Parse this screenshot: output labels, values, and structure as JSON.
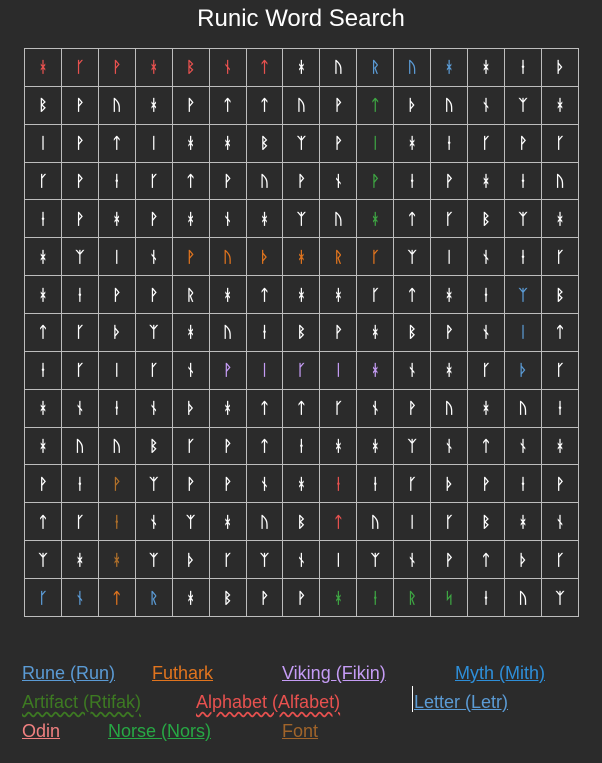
{
  "title": "Runic Word Search",
  "grid": [
    [
      "ᚼ",
      "ᚴ",
      "ᚹ",
      "ᚼ",
      "ᛒ",
      "ᚾ",
      "ᛏ",
      "ᚼ",
      "ᚢ",
      "ᚱ",
      "ᚢ",
      "ᚼ",
      "ᚼ",
      "ᚽ",
      "ᚦ"
    ],
    [
      "ᛒ",
      "ᚹ",
      "ᚢ",
      "ᚼ",
      "ᚹ",
      "ᛏ",
      "ᛏ",
      "ᚢ",
      "ᚹ",
      "ᛏ",
      "ᚦ",
      "ᚢ",
      "ᚾ",
      "ᛉ",
      "ᚼ"
    ],
    [
      "ᛁ",
      "ᚹ",
      "ᛏ",
      "ᛁ",
      "ᚼ",
      "ᚼ",
      "ᛒ",
      "ᛉ",
      "ᚹ",
      "ᛁ",
      "ᚼ",
      "ᚽ",
      "ᚴ",
      "ᚹ",
      "ᚴ"
    ],
    [
      "ᚴ",
      "ᚹ",
      "ᚽ",
      "ᚴ",
      "ᛏ",
      "ᚹ",
      "ᚢ",
      "ᚹ",
      "ᚾ",
      "ᚹ",
      "ᚽ",
      "ᚹ",
      "ᚼ",
      "ᚽ",
      "ᚢ"
    ],
    [
      "ᚽ",
      "ᚹ",
      "ᚼ",
      "ᚹ",
      "ᚼ",
      "ᚾ",
      "ᚼ",
      "ᛉ",
      "ᚢ",
      "ᚼ",
      "ᛏ",
      "ᚴ",
      "ᛒ",
      "ᛉ",
      "ᚼ"
    ],
    [
      "ᚼ",
      "ᛉ",
      "ᛁ",
      "ᚾ",
      "ᚹ",
      "ᚢ",
      "ᚦ",
      "ᚼ",
      "ᚱ",
      "ᚴ",
      "ᛉ",
      "ᛁ",
      "ᚾ",
      "ᚽ",
      "ᚴ"
    ],
    [
      "ᚼ",
      "ᚽ",
      "ᚹ",
      "ᚹ",
      "ᚱ",
      "ᚼ",
      "ᛏ",
      "ᚼ",
      "ᚼ",
      "ᚴ",
      "ᛏ",
      "ᚼ",
      "ᚽ",
      "ᛉ",
      "ᛒ"
    ],
    [
      "ᛏ",
      "ᚴ",
      "ᚦ",
      "ᛉ",
      "ᚼ",
      "ᚢ",
      "ᚽ",
      "ᛒ",
      "ᚹ",
      "ᚼ",
      "ᛒ",
      "ᚹ",
      "ᚾ",
      "ᛁ",
      "ᛏ"
    ],
    [
      "ᚽ",
      "ᚴ",
      "ᛁ",
      "ᚴ",
      "ᚾ",
      "ᚹ",
      "ᛁ",
      "ᚴ",
      "ᛁ",
      "ᚼ",
      "ᚾ",
      "ᚼ",
      "ᚴ",
      "ᚦ",
      "ᚴ"
    ],
    [
      "ᚼ",
      "ᚾ",
      "ᚽ",
      "ᚾ",
      "ᚦ",
      "ᚼ",
      "ᛏ",
      "ᛏ",
      "ᚴ",
      "ᚾ",
      "ᚹ",
      "ᚢ",
      "ᚼ",
      "ᚢ",
      "ᚽ"
    ],
    [
      "ᚼ",
      "ᚢ",
      "ᚢ",
      "ᛒ",
      "ᚴ",
      "ᚹ",
      "ᛏ",
      "ᚽ",
      "ᚼ",
      "ᚼ",
      "ᛉ",
      "ᚾ",
      "ᛏ",
      "ᚾ",
      "ᚼ"
    ],
    [
      "ᚹ",
      "ᚽ",
      "ᚹ",
      "ᛉ",
      "ᚹ",
      "ᚹ",
      "ᚾ",
      "ᚼ",
      "ᚽ",
      "ᚽ",
      "ᚴ",
      "ᚦ",
      "ᚹ",
      "ᚽ",
      "ᚹ"
    ],
    [
      "ᛏ",
      "ᚴ",
      "ᚽ",
      "ᚾ",
      "ᛉ",
      "ᚼ",
      "ᚢ",
      "ᛒ",
      "ᛏ",
      "ᚢ",
      "ᛁ",
      "ᚴ",
      "ᛒ",
      "ᚼ",
      "ᚾ"
    ],
    [
      "ᛉ",
      "ᚼ",
      "ᚼ",
      "ᛉ",
      "ᚦ",
      "ᚴ",
      "ᛉ",
      "ᚾ",
      "ᛁ",
      "ᛉ",
      "ᚾ",
      "ᚹ",
      "ᛏ",
      "ᚦ",
      "ᚴ"
    ],
    [
      "ᚴ",
      "ᚾ",
      "ᛏ",
      "ᚱ",
      "ᚼ",
      "ᛒ",
      "ᚹ",
      "ᚹ",
      "ᚼ",
      "ᚽ",
      "ᚱ",
      "ᛋ",
      "ᚽ",
      "ᚢ",
      "ᛉ"
    ]
  ],
  "highlights": [
    {
      "r": 0,
      "c": 0,
      "color": "#e8514f"
    },
    {
      "r": 0,
      "c": 1,
      "color": "#e8514f"
    },
    {
      "r": 0,
      "c": 2,
      "color": "#e8514f"
    },
    {
      "r": 0,
      "c": 3,
      "color": "#e8514f"
    },
    {
      "r": 0,
      "c": 4,
      "color": "#e8514f"
    },
    {
      "r": 0,
      "c": 5,
      "color": "#e8514f"
    },
    {
      "r": 0,
      "c": 6,
      "color": "#e8514f"
    },
    {
      "r": 0,
      "c": 9,
      "color": "#5b9bd5"
    },
    {
      "r": 0,
      "c": 10,
      "color": "#5b9bd5"
    },
    {
      "r": 0,
      "c": 11,
      "color": "#5b9bd5"
    },
    {
      "r": 1,
      "c": 9,
      "color": "#3ea643"
    },
    {
      "r": 2,
      "c": 9,
      "color": "#3ea643"
    },
    {
      "r": 3,
      "c": 9,
      "color": "#3ea643"
    },
    {
      "r": 4,
      "c": 9,
      "color": "#3ea643"
    },
    {
      "r": 5,
      "c": 4,
      "color": "#e0741e"
    },
    {
      "r": 5,
      "c": 5,
      "color": "#e0741e"
    },
    {
      "r": 5,
      "c": 6,
      "color": "#e0741e"
    },
    {
      "r": 5,
      "c": 7,
      "color": "#e0741e"
    },
    {
      "r": 5,
      "c": 8,
      "color": "#e0741e"
    },
    {
      "r": 5,
      "c": 9,
      "color": "#e0741e"
    },
    {
      "r": 6,
      "c": 13,
      "color": "#5b9bd5"
    },
    {
      "r": 7,
      "c": 13,
      "color": "#5b9bd5"
    },
    {
      "r": 8,
      "c": 13,
      "color": "#5b9bd5"
    },
    {
      "r": 8,
      "c": 5,
      "color": "#c59cf5"
    },
    {
      "r": 8,
      "c": 6,
      "color": "#c59cf5"
    },
    {
      "r": 8,
      "c": 7,
      "color": "#c59cf5"
    },
    {
      "r": 8,
      "c": 8,
      "color": "#c59cf5"
    },
    {
      "r": 8,
      "c": 9,
      "color": "#c59cf5"
    },
    {
      "r": 11,
      "c": 2,
      "color": "#b0702a"
    },
    {
      "r": 12,
      "c": 2,
      "color": "#b0702a"
    },
    {
      "r": 13,
      "c": 2,
      "color": "#b0702a"
    },
    {
      "r": 14,
      "c": 2,
      "color": "#b0702a"
    },
    {
      "r": 11,
      "c": 8,
      "color": "#e8514f"
    },
    {
      "r": 12,
      "c": 8,
      "color": "#e8514f"
    },
    {
      "r": 14,
      "c": 0,
      "color": "#5b9bd5"
    },
    {
      "r": 14,
      "c": 1,
      "color": "#5b9bd5"
    },
    {
      "r": 14,
      "c": 2,
      "color": "#e0741e"
    },
    {
      "r": 14,
      "c": 3,
      "color": "#5b9bd5"
    },
    {
      "r": 14,
      "c": 8,
      "color": "#3ea643"
    },
    {
      "r": 14,
      "c": 9,
      "color": "#3ea643"
    },
    {
      "r": 14,
      "c": 10,
      "color": "#3ea643"
    },
    {
      "r": 14,
      "c": 11,
      "color": "#3ea643"
    }
  ],
  "legend": [
    {
      "text": "Rune (Run)",
      "color": "#5b9bd5"
    },
    {
      "text": " Futhark",
      "color": "#e0741e"
    },
    {
      "text": "Viking (Fikin)",
      "color": "#c59cf5"
    },
    {
      "text": "Myth (Mith) ",
      "color": "#2e8fd9"
    },
    {
      "text": "Artifact (Rtifak)",
      "color": "#3d7a22"
    },
    {
      "text": "Alphabet (Alfabet)",
      "color": "#e8514f"
    },
    {
      "text": "Letter (Letr)",
      "color": "#5b9bd5"
    },
    {
      "text": "Odin",
      "color": "#f08080"
    },
    {
      "text": "Norse (Nors)",
      "color": "#27a844"
    },
    {
      "text": "Font",
      "color": "#a0642a"
    }
  ]
}
